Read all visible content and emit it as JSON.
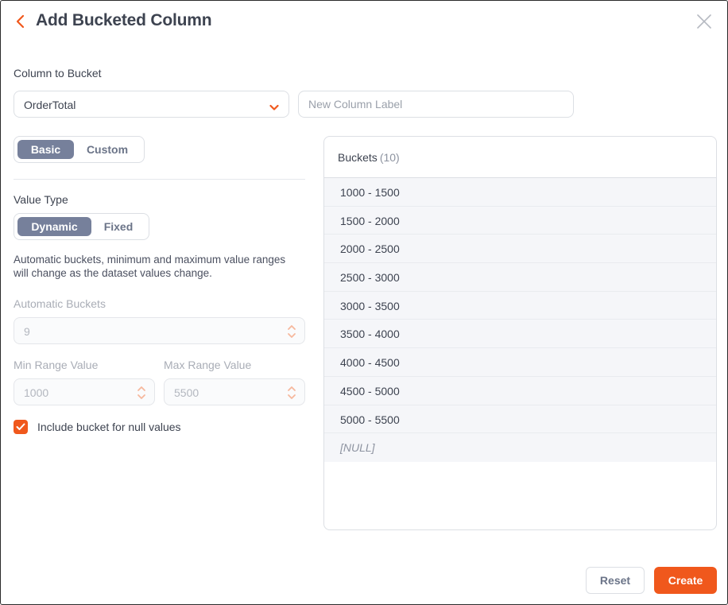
{
  "header": {
    "title": "Add Bucketed Column",
    "back_icon": "chevron-left-icon",
    "close_icon": "close-icon"
  },
  "column_to_bucket": {
    "label": "Column to Bucket",
    "selected": "OrderTotal",
    "label_placeholder": "New Column Label"
  },
  "mode_toggle": {
    "options": [
      "Basic",
      "Custom"
    ],
    "selected": "Basic"
  },
  "value_type": {
    "label": "Value Type",
    "options": [
      "Dynamic",
      "Fixed"
    ],
    "selected": "Dynamic",
    "description": "Automatic buckets, minimum and maximum value ranges will change as the dataset values change."
  },
  "automatic_buckets": {
    "label": "Automatic Buckets",
    "value": "9"
  },
  "min_range": {
    "label": "Min Range Value",
    "value": "1000"
  },
  "max_range": {
    "label": "Max Range Value",
    "value": "5500"
  },
  "null_bucket": {
    "label": "Include bucket for null values",
    "checked": true
  },
  "buckets": {
    "title": "Buckets",
    "count": "(10)",
    "items": [
      "1000 - 1500",
      "1500 - 2000",
      "2000 - 2500",
      "2500 - 3000",
      "3000 - 3500",
      "3500 - 4000",
      "4000 - 4500",
      "4500 - 5000",
      "5000 - 5500",
      "[NULL]"
    ]
  },
  "footer": {
    "reset_label": "Reset",
    "create_label": "Create"
  },
  "colors": {
    "accent": "#f0581c",
    "toggle_active": "#76809b",
    "text": "#3d4350"
  }
}
